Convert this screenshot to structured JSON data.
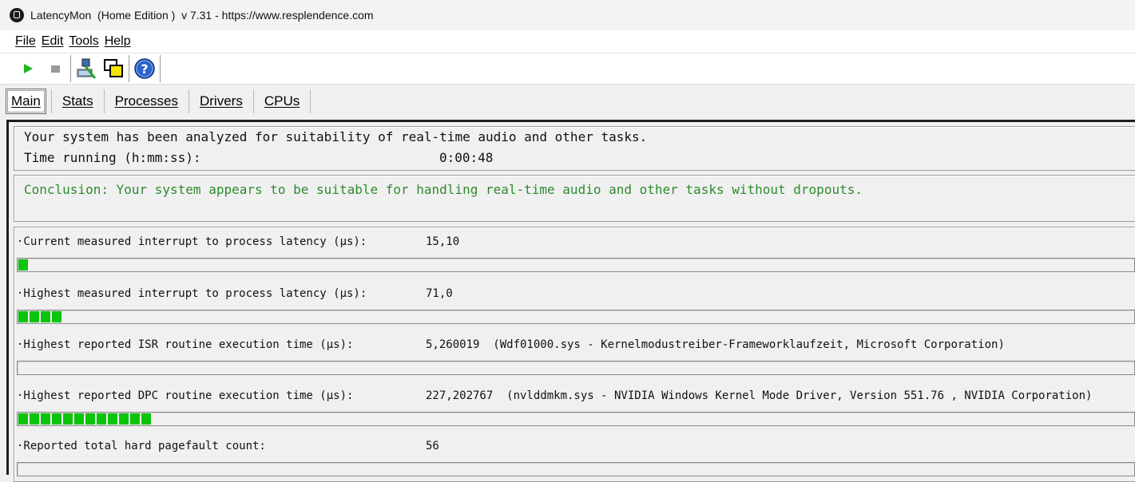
{
  "window": {
    "title": "LatencyMon  (Home Edition )  v 7.31 - https://www.resplendence.com"
  },
  "menu": {
    "items": [
      {
        "label": "File"
      },
      {
        "label": "Edit"
      },
      {
        "label": "Tools"
      },
      {
        "label": "Help"
      }
    ]
  },
  "toolbar": {
    "icons": [
      "play-icon",
      "stop-icon",
      "analyze-icon",
      "windows-icon",
      "help-icon"
    ]
  },
  "tabs": [
    {
      "label": "Main"
    },
    {
      "label": "Stats"
    },
    {
      "label": "Processes"
    },
    {
      "label": "Drivers"
    },
    {
      "label": "CPUs"
    }
  ],
  "main": {
    "status_line": "Your system has been analyzed for suitability of real-time audio and other tasks.",
    "time_running_label": "Time running (h:mm:ss):",
    "time_running_value": "0:00:48",
    "conclusion": "Conclusion: Your system appears to be suitable for handling real-time audio and other tasks without dropouts.",
    "conclusion_color": "#2e8b2e",
    "bar_color": "#0bc40b",
    "metrics": [
      {
        "label": "·Current measured interrupt to process latency (µs):",
        "value": "15,10",
        "bar_segments": 1
      },
      {
        "label": "·Highest measured interrupt to process latency (µs):",
        "value": "71,0",
        "bar_segments": 4
      },
      {
        "label": "·Highest reported ISR routine execution time (µs):",
        "value": "5,260019  (Wdf01000.sys - Kernelmodustreiber-Frameworklaufzeit, Microsoft Corporation)",
        "bar_segments": 0
      },
      {
        "label": "·Highest reported DPC routine execution time (µs):",
        "value": "227,202767  (nvlddmkm.sys - NVIDIA Windows Kernel Mode Driver, Version 551.76 , NVIDIA Corporation)",
        "bar_segments": 12
      },
      {
        "label": "·Reported total hard pagefault count:",
        "value": "56",
        "bar_segments": 0
      }
    ]
  }
}
